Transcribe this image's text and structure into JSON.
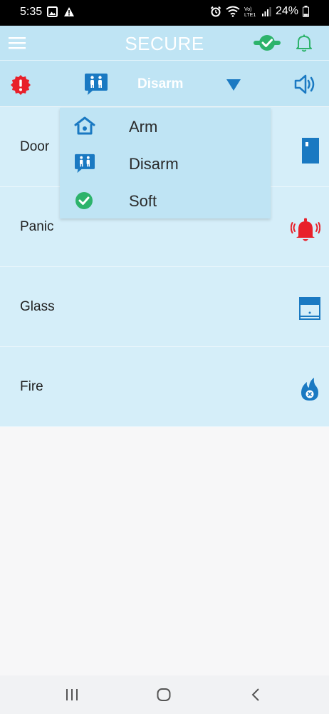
{
  "status_bar": {
    "time": "5:35",
    "battery": "24%",
    "icons": [
      "image-icon",
      "warning-icon",
      "alarm-icon",
      "wifi-icon",
      "volte-icon",
      "signal-icon",
      "battery-icon"
    ]
  },
  "app_bar": {
    "title": "SECURE",
    "icons": [
      "menu-icon",
      "check-shield-icon",
      "bell-icon"
    ]
  },
  "mode_bar": {
    "selected_mode": "Disarm",
    "icons": [
      "alert-icon",
      "disarm-icon",
      "dropdown-arrow-icon",
      "speaker-icon"
    ]
  },
  "dropdown": {
    "options": [
      {
        "label": "Arm",
        "icon": "home-lock-icon"
      },
      {
        "label": "Disarm",
        "icon": "disarm-icon"
      },
      {
        "label": "Soft",
        "icon": "check-circle-icon"
      }
    ]
  },
  "sensors": [
    {
      "label": "Door",
      "icon": "door-icon"
    },
    {
      "label": "Panic",
      "icon": "alarm-bell-icon"
    },
    {
      "label": "Glass",
      "icon": "window-icon"
    },
    {
      "label": "Fire",
      "icon": "fire-icon"
    }
  ],
  "colors": {
    "header_bg": "#bfe4f4",
    "row_bg": "#d5eef9",
    "accent_blue": "#1a79c2",
    "alert_red": "#e8202a",
    "ok_green": "#2db36b"
  }
}
